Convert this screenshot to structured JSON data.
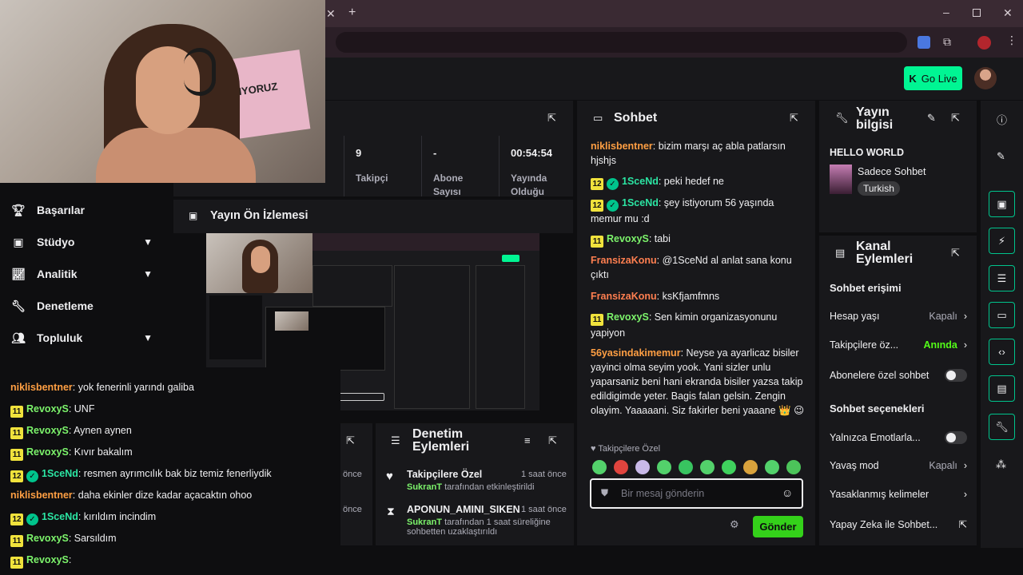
{
  "browser": {
    "tab_close": "✕",
    "new_tab": "+"
  },
  "header": {
    "go_live": "Go Live"
  },
  "webcam": {
    "poster_text": "YAPIYORUZ"
  },
  "nav": {
    "items": [
      {
        "label": "Başarılar"
      },
      {
        "label": "Stüdyo"
      },
      {
        "label": "Analitik"
      },
      {
        "label": "Denetleme"
      },
      {
        "label": "Topluluk"
      }
    ]
  },
  "stats": {
    "followers_value": "9",
    "followers_label": "Takipçi",
    "subs_value": "-",
    "subs_label": "Abone Sayısı",
    "live_value": "00:54:54",
    "live_label": "Yayında Olduğu"
  },
  "preview": {
    "title": "Yayın Ön İzlemesi"
  },
  "left_chat": [
    {
      "badge": "",
      "verified": false,
      "user": "niklisbentner",
      "color": "o",
      "text": ": yok fenerinli yarındı galiba"
    },
    {
      "badge": "11",
      "verified": false,
      "user": "RevoxyS",
      "color": "g",
      "text": ": UNF"
    },
    {
      "badge": "11",
      "verified": false,
      "user": "RevoxyS",
      "color": "g",
      "text": ": Aynen aynen"
    },
    {
      "badge": "11",
      "verified": false,
      "user": "RevoxyS",
      "color": "g",
      "text": ": Kıvır bakalım"
    },
    {
      "badge": "12",
      "verified": true,
      "user": "1SceNd",
      "color": "t",
      "text": ": resmen ayrımcılık bak biz temiz fenerliydik"
    },
    {
      "badge": "",
      "verified": false,
      "user": "niklisbentner",
      "color": "o",
      "text": ": daha ekinler dize kadar açacaktın ohoo"
    },
    {
      "badge": "12",
      "verified": true,
      "user": "1SceNd",
      "color": "t",
      "text": ": kırıldım incindim"
    },
    {
      "badge": "11",
      "verified": false,
      "user": "RevoxyS",
      "color": "g",
      "text": ": Sarsıldım"
    },
    {
      "badge": "11",
      "verified": false,
      "user": "RevoxyS",
      "color": "g",
      "text": ":"
    }
  ],
  "moderation": {
    "title": "Denetim Eylemleri",
    "items": [
      {
        "title": "Takipçilere Özel",
        "time": "1 saat önce",
        "actor": "SukranT",
        "desc": " tarafından etkinleştirildi"
      },
      {
        "title": "APONUN_AMINI_SIKEN",
        "time": "1 saat önce",
        "actor": "SukranT",
        "desc": " tarafından 1 saat süreliğine sohbetten uzaklaştırıldı"
      }
    ],
    "partial_time": "önce"
  },
  "chat": {
    "title": "Sohbet",
    "messages": [
      {
        "badge": "",
        "verified": false,
        "user": "niklisbentner",
        "color": "o",
        "text": ": bizim marşı aç abla patlarsın hjshjs"
      },
      {
        "badge": "12",
        "verified": true,
        "user": "1SceNd",
        "color": "t",
        "text": ": peki hedef ne"
      },
      {
        "badge": "12",
        "verified": true,
        "user": "1SceNd",
        "color": "t",
        "text": ": şey istiyorum 56 yaşında memur mu :d"
      },
      {
        "badge": "11",
        "verified": false,
        "user": "RevoxyS",
        "color": "g",
        "text": ": tabi"
      },
      {
        "badge": "",
        "verified": false,
        "user": "FransizaKonu",
        "color": "r",
        "text": ": @1SceNd al anlat sana konu çıktı"
      },
      {
        "badge": "",
        "verified": false,
        "user": "FransizaKonu",
        "color": "r",
        "text": ": ksKfjamfmns"
      },
      {
        "badge": "11",
        "verified": false,
        "user": "RevoxyS",
        "color": "g",
        "text": ": Sen kimin organizasyonunu yapiyon"
      },
      {
        "badge": "",
        "verified": false,
        "user": "56yasindakimemur",
        "color": "o",
        "text": ": Neyse ya ayarlicaz bisiler yayinci olma seyim yook. Yani sizler unlu yaparsaniz beni hani ekranda bisiler yazsa takip edildigimde yeter. Bagis falan gelsin. Zengin olayim. Yaaaaani. Siz fakirler beni yaaane 👑 😉"
      }
    ],
    "followers_only": "Takipçilere Özel",
    "placeholder": "Bir mesaj gönderin",
    "send": "Gönder"
  },
  "stream_info": {
    "title": "Yayın bilgisi",
    "stream_title": "HELLO WORLD",
    "category": "Sadece Sohbet",
    "tag": "Turkish"
  },
  "channel_actions": {
    "title": "Kanal Eylemleri",
    "section1": "Sohbet erişimi",
    "account_age": "Hesap yaşı",
    "account_age_val": "Kapalı",
    "followers_only": "Takipçilere öz...",
    "followers_only_val": "Anında",
    "subs_only": "Abonelere özel sohbet",
    "section2": "Sohbet seçenekleri",
    "emote_only": "Yalnızca Emotlarla...",
    "slow_mode": "Yavaş mod",
    "slow_mode_val": "Kapalı",
    "banned_words": "Yasaklanmış kelimeler",
    "ai_chat": "Yapay Zeka ile Sohbet..."
  },
  "colors": {
    "accent": "#00f593",
    "send": "#34d11a",
    "badge": "#f0e23c"
  }
}
